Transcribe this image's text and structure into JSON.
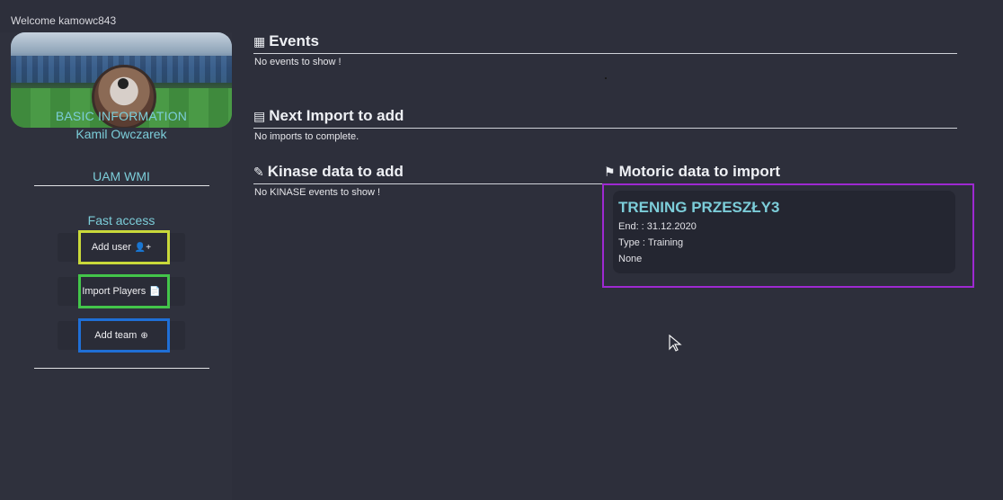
{
  "welcome": "Welcome kamowc843",
  "sidebar": {
    "basic_info": "BASIC INFORMATION",
    "name": "Kamil Owczarek",
    "org": "UAM WMI",
    "fast_access": "Fast access",
    "buttons": [
      {
        "label": "Add user",
        "icon": "user-plus-icon",
        "glyph": "👤+"
      },
      {
        "label": "Import Players",
        "icon": "file-import-icon",
        "glyph": "📄"
      },
      {
        "label": "Add team",
        "icon": "plus-circle-icon",
        "glyph": "⊕"
      }
    ],
    "frame_colors": [
      "#c9d93a",
      "#43c54a",
      "#1f6fd6"
    ]
  },
  "sections": {
    "events": {
      "title": "Events",
      "empty": "No events to show !"
    },
    "imports": {
      "title": "Next Import to add",
      "empty": "No imports to complete."
    },
    "kinase": {
      "title": "Kinase data to add",
      "empty": "No KINASE events to show !"
    },
    "motoric": {
      "title": "Motoric data to import"
    }
  },
  "motoric_card": {
    "title": "TRENING PRZESZŁY3",
    "end": "End: : 31.12.2020",
    "type": "Type : Training",
    "note": "None",
    "highlight_color": "#9e29d1"
  },
  "colors": {
    "accent": "#7ccdd9",
    "background": "#2d2f3b"
  }
}
